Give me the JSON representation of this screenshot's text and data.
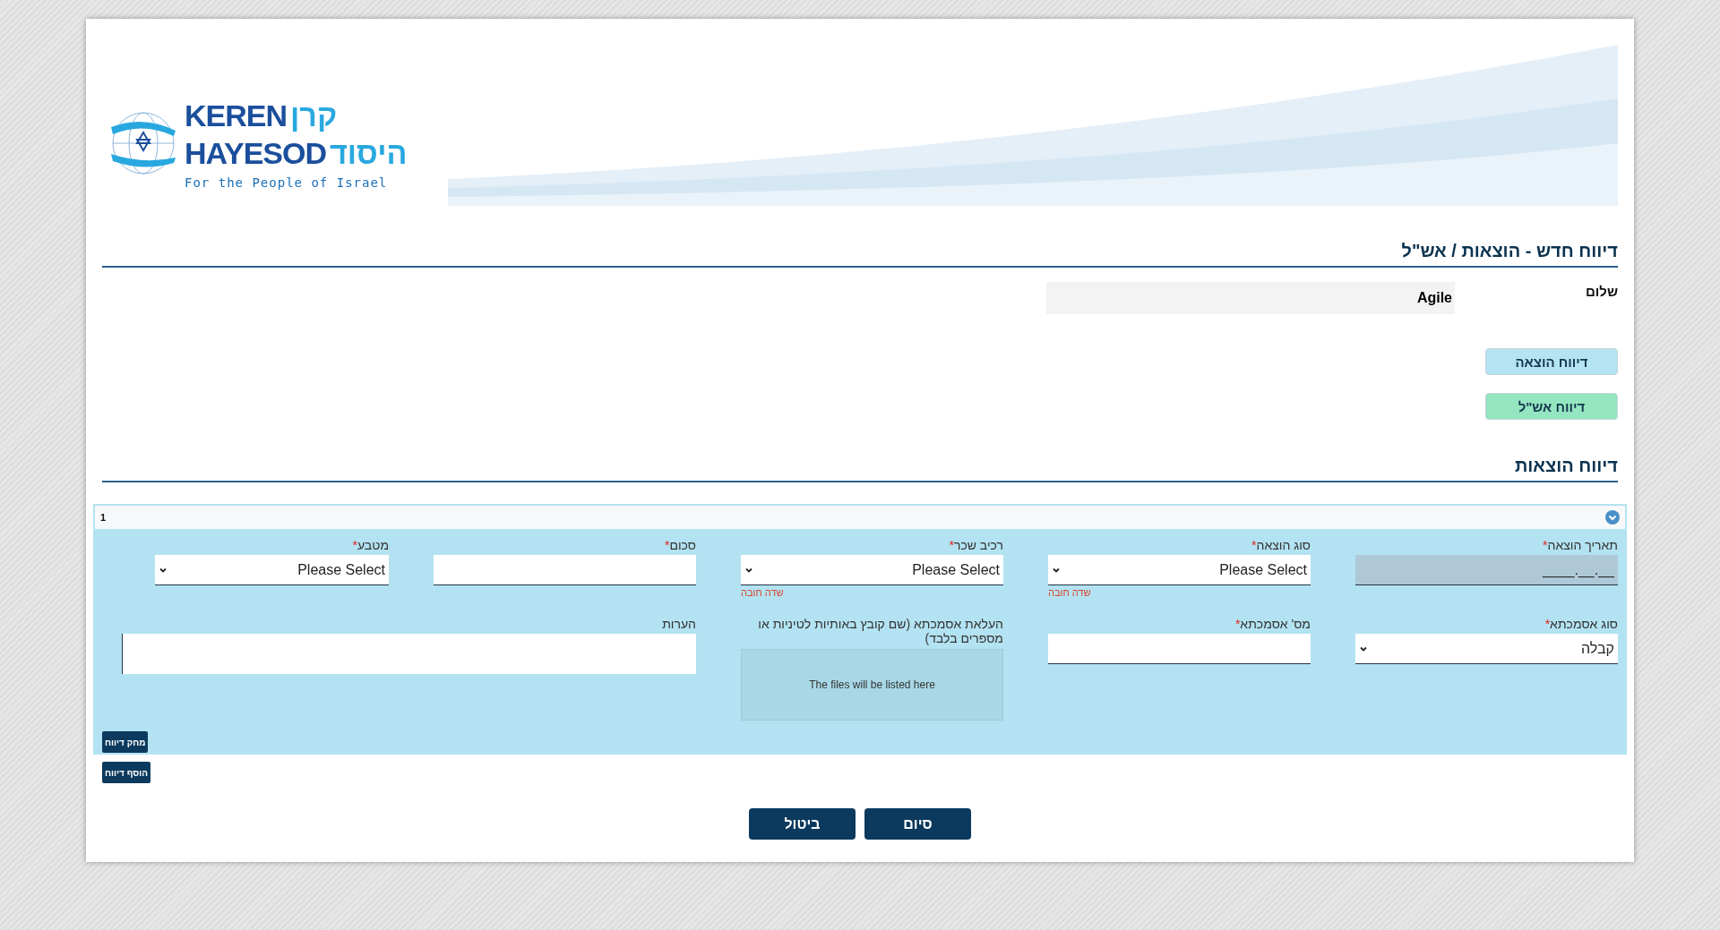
{
  "logo": {
    "latin_top": "KEREN",
    "latin_bottom": "HAYESOD",
    "hebrew_top": "קרן",
    "hebrew_bottom": "היסוד",
    "tagline": "For the People of Israel"
  },
  "page_title": "דיווח חדש - הוצאות / אש\"ל",
  "greeting": {
    "label": "שלום",
    "value": "Agile"
  },
  "report_buttons": [
    {
      "label": "דיווח הוצאה",
      "kind": "expense"
    },
    {
      "label": "דיווח אש\"ל",
      "kind": "per_diem"
    }
  ],
  "section_title": "דיווח הוצאות",
  "entry": {
    "number": "1",
    "expanded": true,
    "rows": [
      [
        {
          "label": "תאריך הוצאה",
          "required_mark": "*",
          "kind": "date",
          "value": "__.__.____"
        },
        {
          "label": "סוג הוצאה",
          "required_mark": "*",
          "kind": "select",
          "value": "Please Select",
          "error": "שדה חובה"
        },
        {
          "label": "רכיב שכר",
          "required_mark": "*",
          "kind": "select",
          "value": "Please Select",
          "error": "שדה חובה"
        },
        {
          "label": "סכום",
          "required_mark": "*",
          "kind": "text"
        },
        {
          "label": "מטבע",
          "required_mark": "*",
          "kind": "select",
          "value": "Please Select"
        }
      ],
      [
        {
          "label": "סוג אסמכתא",
          "required_mark": "*",
          "kind": "select",
          "value": "קבלה"
        },
        {
          "label": "מס' אסמכתא",
          "required_mark": "*",
          "kind": "text"
        },
        {
          "label": "העלאת אסמכתא (שם קובץ באותיות לטיניות או מספרים בלבד)",
          "kind": "upload",
          "placeholder": "The files will be listed here"
        },
        {
          "label": "הערות",
          "kind": "notes"
        }
      ]
    ],
    "delete_button": "מחק דיווח"
  },
  "add_button": "הוסף דיווח",
  "footer_buttons": [
    "סיום",
    "ביטול"
  ]
}
